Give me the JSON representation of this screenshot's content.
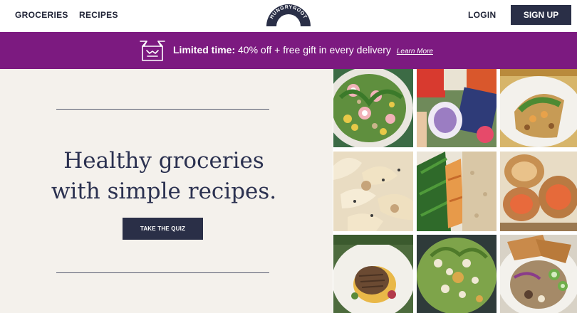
{
  "header": {
    "nav": {
      "groceries": "GROCERIES",
      "recipes": "RECIPES",
      "login": "LOGIN"
    },
    "logo_text": "HUNGRYROOT",
    "signup_label": "SIGN UP"
  },
  "promo": {
    "icon": "gift-box-icon",
    "strong": "Limited time:",
    "text": " 40% off + free gift in every delivery",
    "link": "Learn More"
  },
  "hero": {
    "title": "Healthy groceries with simple recipes.",
    "cta_label": "TAKE THE QUIZ"
  },
  "gallery": {
    "tiles": [
      "salad-photo",
      "groceries-photo",
      "flatbread-photo",
      "pasta-photo",
      "salmon-greenbeans-photo",
      "baked-dish-photo",
      "chicken-plate-photo",
      "grain-salad-photo",
      "grain-bowl-photo"
    ]
  },
  "colors": {
    "navy": "#2a2f47",
    "promo_purple": "#7c1a80",
    "hero_bg": "#f4f1ec"
  }
}
